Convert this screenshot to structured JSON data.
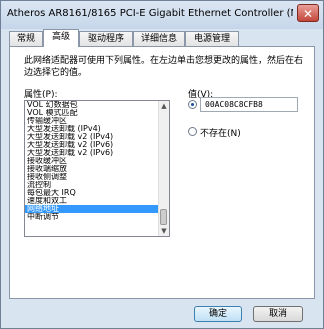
{
  "window": {
    "title": "Atheros AR8161/8165 PCI-E Gigabit Ethernet Controller (N...",
    "close_glyph": "✕"
  },
  "tabs": [
    {
      "label": "常规",
      "active": false
    },
    {
      "label": "高级",
      "active": true
    },
    {
      "label": "驱动程序",
      "active": false
    },
    {
      "label": "详细信息",
      "active": false
    },
    {
      "label": "电源管理",
      "active": false
    }
  ],
  "advanced": {
    "description": "此网络适配器可使用下列属性。在左边单击您想更改的属性，然后在右边选择它的值。",
    "property_label": "属性(P):",
    "properties": [
      "VOL 幻数据包",
      "VOL 模式匹配",
      "传输缓冲区",
      "大型发送卸载 (IPv4)",
      "大型发送卸载 v2 (IPv4)",
      "大型发送卸载 v2 (IPv6)",
      "大型发送卸载 v2 (IPv6)",
      "接收缓冲区",
      "接收端缩放",
      "接收侧调整",
      "流控制",
      "每包最大 IRQ",
      "速度和双工",
      "网络地址",
      "中断调节"
    ],
    "selected_index": 13,
    "value_label": "值(V):",
    "value": "00AC08C8CFB8",
    "value_selected": true,
    "absent_label": "不存在(N)"
  },
  "buttons": {
    "ok": "确定",
    "cancel": "取消"
  },
  "scrollbar": {
    "up_glyph": "▲",
    "down_glyph": "▼"
  }
}
